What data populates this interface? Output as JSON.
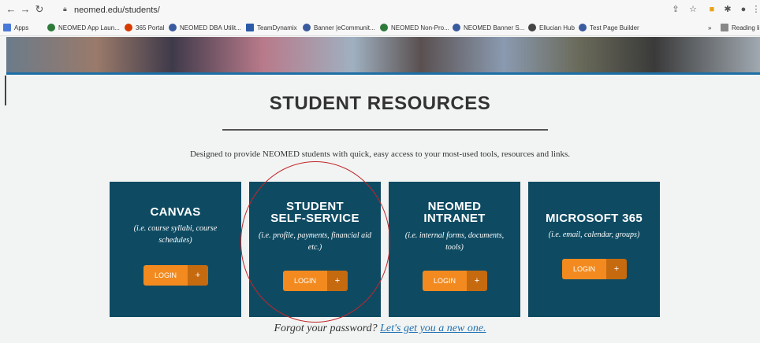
{
  "browser": {
    "url": "neomed.edu/students/",
    "bookmarks": [
      "Apps",
      "NEOMED App Laun...",
      "365 Portal",
      "NEOMED DBA Utilit...",
      "TeamDynamix",
      "Banner |eCommunit...",
      "NEOMED Non-Pro...",
      "NEOMED Banner S...",
      "Ellucian Hub",
      "Test Page Builder"
    ],
    "reading_list": "Reading li"
  },
  "page": {
    "title": "STUDENT RESOURCES",
    "description": "Designed to provide NEOMED students with quick, easy access to your most-used tools, resources and links.",
    "cards": [
      {
        "title_l1": "CANVAS",
        "title_l2": "",
        "subtitle": "(i.e. course syllabi, course schedules)",
        "button": "LOGIN",
        "plus": "+"
      },
      {
        "title_l1": "STUDENT",
        "title_l2": "SELF-SERVICE",
        "subtitle": "(i.e. profile, payments, financial aid etc.)",
        "button": "LOGIN",
        "plus": "+"
      },
      {
        "title_l1": "NEOMED",
        "title_l2": "INTRANET",
        "subtitle": "(i.e. internal forms, documents, tools)",
        "button": "LOGIN",
        "plus": "+"
      },
      {
        "title_l1": "MICROSOFT 365",
        "title_l2": "",
        "subtitle": "(i.e. email, calendar, groups)",
        "button": "LOGIN",
        "plus": "+"
      }
    ],
    "forgot_prefix": "Forgot your password?",
    "forgot_link": "Let's get you a new one."
  },
  "colors": {
    "card_bg": "#0e4b63",
    "login_orange": "#f28a1f",
    "link_blue": "#1f6fb0",
    "annotation_red": "#c0262a"
  }
}
